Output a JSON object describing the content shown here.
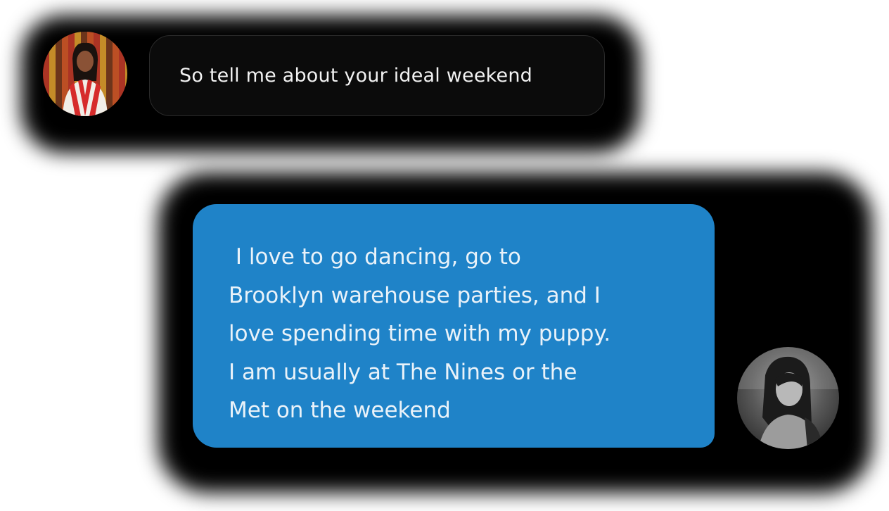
{
  "conversation": {
    "messages": [
      {
        "sender": "other",
        "text": "So tell me about your ideal weekend",
        "avatar_icon": "user-avatar-woman-red-top"
      },
      {
        "sender": "self",
        "text": " I love to go dancing, go to\nBrooklyn warehouse parties, and I\nlove spending time with my puppy.\nI am usually at The Nines or the\nMet on the weekend",
        "avatar_icon": "user-avatar-woman-bw"
      }
    ]
  },
  "colors": {
    "received_bubble": "#0b0b0b",
    "sent_bubble": "#1f83c8",
    "glow": "#000000"
  }
}
